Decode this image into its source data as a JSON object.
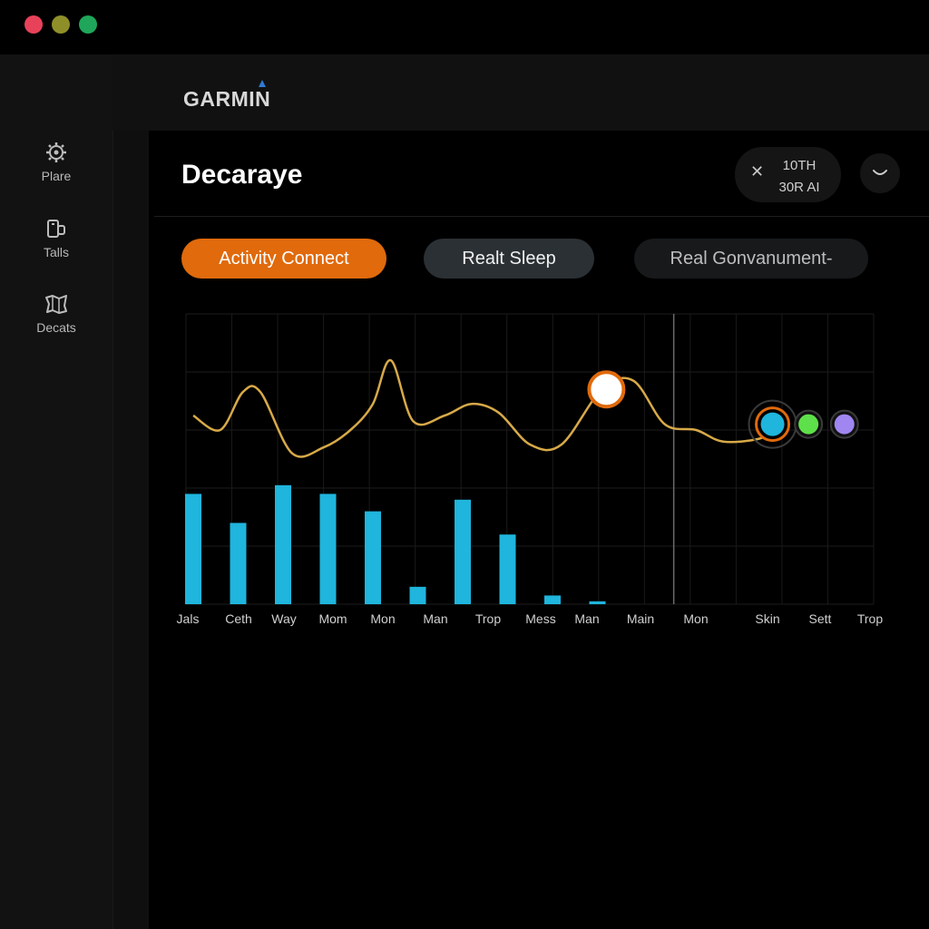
{
  "window": {
    "controls": [
      "close",
      "minimize",
      "maximize"
    ]
  },
  "brand": {
    "name": "GARMIN"
  },
  "sidebar": {
    "items": [
      {
        "label": "Plare",
        "icon": "gear-icon"
      },
      {
        "label": "Talls",
        "icon": "device-icon"
      },
      {
        "label": "Decats",
        "icon": "map-icon"
      }
    ]
  },
  "header": {
    "title": "Decaraye",
    "status_line1": "10TH",
    "status_line2": "30R AI",
    "close_glyph": "✕"
  },
  "tabs": [
    {
      "label": "Activity Connect",
      "active": true
    },
    {
      "label": "Realt Sleep",
      "active": false
    },
    {
      "label": "Real Gonvanument-",
      "active": false
    }
  ],
  "colors": {
    "accent": "#e06a0c",
    "bars": "#1fb5dc",
    "line": "#d7a948",
    "marker_green": "#5ee04a",
    "marker_purple": "#9f86f0"
  },
  "chart_data": {
    "type": "bar",
    "x_labels": [
      "Jals",
      "Ceth",
      "Way",
      "Mom",
      "Mon",
      "Man",
      "Trop",
      "Mess",
      "Man",
      "Main",
      "Mon",
      "Skin",
      "Sett",
      "Trop"
    ],
    "bars": [
      {
        "label": "Jals",
        "value": 38
      },
      {
        "label": "Ceth",
        "value": 28
      },
      {
        "label": "Way",
        "value": 41
      },
      {
        "label": "Mom",
        "value": 38
      },
      {
        "label": "Mon",
        "value": 32
      },
      {
        "label": "Man",
        "value": 6
      },
      {
        "label": "Man",
        "value": 36
      },
      {
        "label": "Trop",
        "value": 24
      },
      {
        "label": "Mess",
        "value": 3
      },
      {
        "label": "Man",
        "value": 1
      }
    ],
    "line": [
      {
        "x": 0,
        "y": 65
      },
      {
        "x": 0.6,
        "y": 60
      },
      {
        "x": 1.1,
        "y": 73
      },
      {
        "x": 1.5,
        "y": 73
      },
      {
        "x": 2.2,
        "y": 52
      },
      {
        "x": 2.9,
        "y": 54
      },
      {
        "x": 3.5,
        "y": 60
      },
      {
        "x": 4.0,
        "y": 69
      },
      {
        "x": 4.4,
        "y": 84
      },
      {
        "x": 4.9,
        "y": 63
      },
      {
        "x": 5.6,
        "y": 65
      },
      {
        "x": 6.2,
        "y": 69
      },
      {
        "x": 6.8,
        "y": 66
      },
      {
        "x": 7.5,
        "y": 55
      },
      {
        "x": 8.2,
        "y": 55
      },
      {
        "x": 9.1,
        "y": 74
      },
      {
        "x": 9.8,
        "y": 77
      },
      {
        "x": 10.5,
        "y": 62
      },
      {
        "x": 11.2,
        "y": 60
      },
      {
        "x": 11.8,
        "y": 56
      },
      {
        "x": 12.6,
        "y": 57
      },
      {
        "x": 12.9,
        "y": 60
      }
    ],
    "highlight": {
      "x": 9.2,
      "y": 74
    },
    "end_markers": [
      {
        "x": 12.9,
        "y": 62,
        "color": "#1fb5dc"
      },
      {
        "x": 13.7,
        "y": 62,
        "color": "#5ee04a"
      },
      {
        "x": 14.5,
        "y": 62,
        "color": "#9f86f0"
      }
    ],
    "cursor_x": 10.7,
    "ylim": [
      0,
      100
    ],
    "grid": true
  }
}
